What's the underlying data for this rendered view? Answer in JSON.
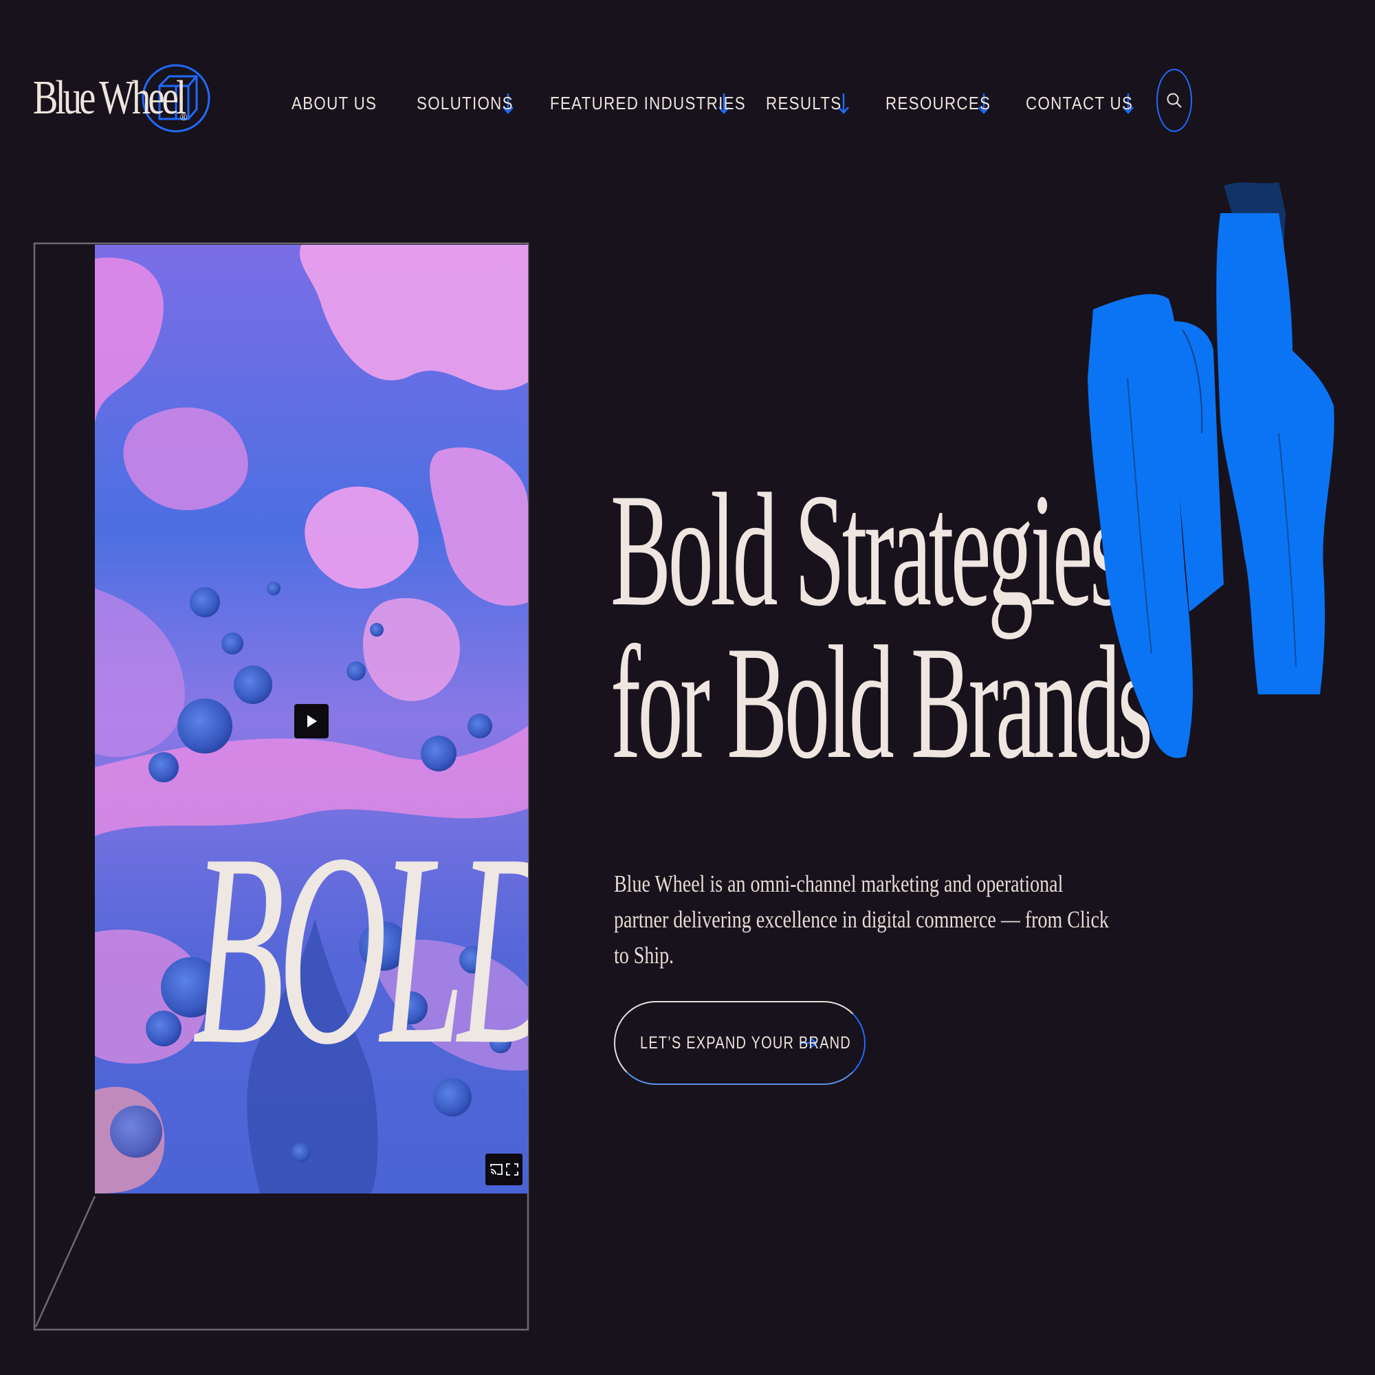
{
  "header": {
    "logo_text": "Blue Wheel",
    "logo_reg": "®",
    "nav": [
      {
        "label": "About Us",
        "has_dropdown": false
      },
      {
        "label": "Solutions",
        "has_dropdown": true
      },
      {
        "label": "Featured Industries",
        "has_dropdown": true
      },
      {
        "label": "Results",
        "has_dropdown": true
      },
      {
        "label": "Resources",
        "has_dropdown": true
      },
      {
        "label": "Contact Us",
        "has_dropdown": true
      }
    ],
    "search_icon": "search-icon",
    "dropdown_icon": "arrow-down-icon"
  },
  "video": {
    "overlay_word": "BOLD",
    "play_icon": "play-icon",
    "controls": [
      "cast-icon",
      "fullscreen-icon"
    ]
  },
  "hero": {
    "title_line1": "Bold Strategies",
    "title_line2": "for Bold Brands",
    "description": "Blue Wheel is an omni-channel marketing and operational partner delivering excellence in digital commerce — from Click to Ship.",
    "cta_label": "LET’S EXPAND YOUR BRAND",
    "cta_icon": "arrow-right-icon"
  },
  "colors": {
    "background": "#17121b",
    "accent_blue": "#1f6bff",
    "brush_blue": "#0a74f5",
    "text": "#efe6e1",
    "video_pink": "#e98be6",
    "video_blue": "#4a6fe0"
  }
}
